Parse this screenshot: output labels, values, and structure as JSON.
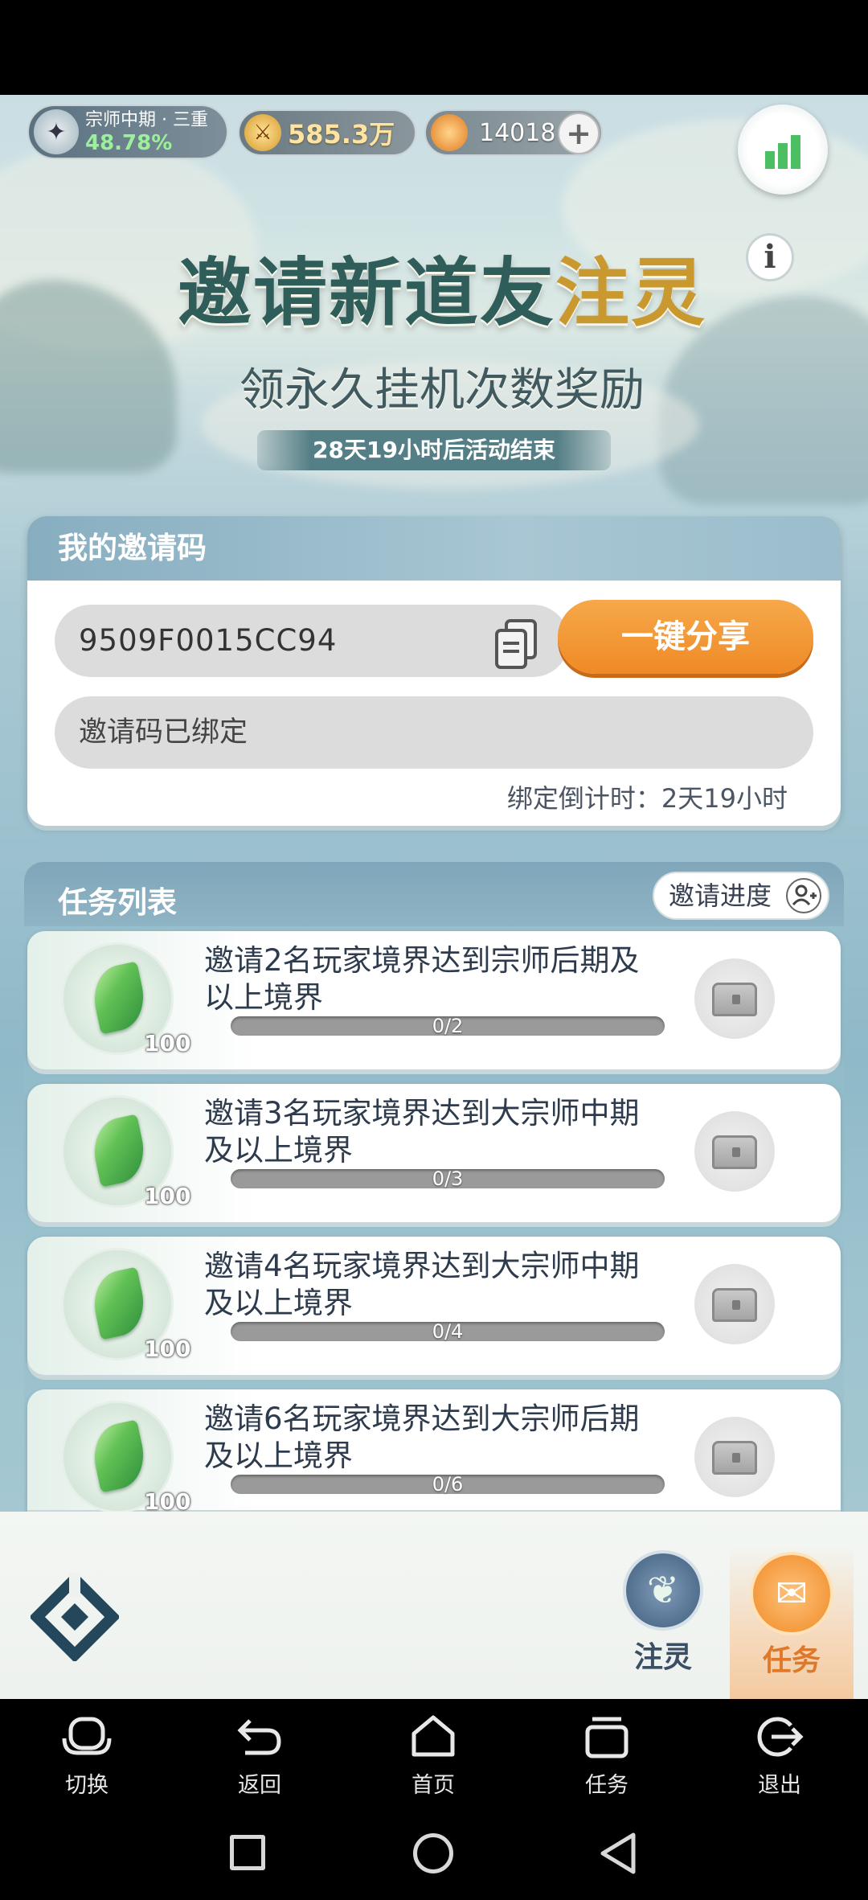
{
  "header": {
    "realm_label": "宗师中期 · 三重",
    "realm_percent": "48.78%",
    "power": "585.3万",
    "currency": "14018",
    "add_icon": "plus-icon",
    "stats_icon": "bar-chart-icon"
  },
  "banner": {
    "title_part1": "邀请新道友",
    "title_part2": "注灵",
    "subtitle": "领永久挂机次数奖励",
    "countdown": "28天19小时后活动结束",
    "info_icon": "info-icon"
  },
  "invite": {
    "section_title": "我的邀请码",
    "code": "9509F0015CC94",
    "copy_icon": "copy-icon",
    "share_button": "一键分享",
    "bind_status": "邀请码已绑定",
    "bind_countdown": "绑定倒计时：2天19小时"
  },
  "tasks": {
    "section_title": "任务列表",
    "progress_button": "邀请进度",
    "items": [
      {
        "title": "邀请2名玩家境界达到宗师后期及以上境界",
        "reward_count": "100",
        "progress_text": "0/2",
        "progress": 0
      },
      {
        "title": "邀请3名玩家境界达到大宗师中期及以上境界",
        "reward_count": "100",
        "progress_text": "0/3",
        "progress": 0
      },
      {
        "title": "邀请4名玩家境界达到大宗师中期及以上境界",
        "reward_count": "100",
        "progress_text": "0/4",
        "progress": 0
      },
      {
        "title": "邀请6名玩家境界达到大宗师后期及以上境界",
        "reward_count": "100",
        "progress_text": "0/6",
        "progress": 0
      }
    ]
  },
  "bottom_tabs": [
    {
      "label": "注灵",
      "icon": "leaf-icon",
      "active": false
    },
    {
      "label": "任务",
      "icon": "scroll-icon",
      "active": true
    }
  ],
  "system_nav": [
    {
      "label": "切换",
      "icon": "switch-icon"
    },
    {
      "label": "返回",
      "icon": "back-icon"
    },
    {
      "label": "首页",
      "icon": "home-icon"
    },
    {
      "label": "任务",
      "icon": "tasks-icon"
    },
    {
      "label": "退出",
      "icon": "exit-icon"
    }
  ],
  "colors": {
    "accent_orange": "#f08a2a",
    "active_tab": "#e0782a",
    "panel_header": "#8fb6c8",
    "text_dark": "#2e3b4d"
  }
}
